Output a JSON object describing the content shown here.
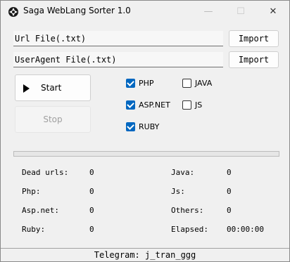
{
  "window": {
    "title": "Saga WebLang Sorter 1.0"
  },
  "titlebar": {
    "minimize": "—",
    "maximize": "☐",
    "close": "✕"
  },
  "inputs": {
    "url_file": "Url File(.txt)",
    "useragent_file": "UserAgent File(.txt)"
  },
  "buttons": {
    "import_url": "Import",
    "import_useragent": "Import",
    "start": "Start",
    "stop": "Stop"
  },
  "checkboxes": [
    {
      "label": "PHP",
      "checked": true
    },
    {
      "label": "JAVA",
      "checked": false
    },
    {
      "label": "ASP.NET",
      "checked": true
    },
    {
      "label": "JS",
      "checked": false
    },
    {
      "label": "RUBY",
      "checked": true
    }
  ],
  "progress": {
    "value": 0
  },
  "stats": {
    "dead_urls": {
      "label": "Dead urls:",
      "value": "0"
    },
    "php": {
      "label": "Php:",
      "value": "0"
    },
    "aspnet": {
      "label": "Asp.net:",
      "value": "0"
    },
    "ruby": {
      "label": "Ruby:",
      "value": "0"
    },
    "java": {
      "label": "Java:",
      "value": "0"
    },
    "js": {
      "label": "Js:",
      "value": "0"
    },
    "others": {
      "label": "Others:",
      "value": "0"
    },
    "elapsed": {
      "label": "Elapsed:",
      "value": "00:00:00"
    }
  },
  "footer": {
    "text": "Telegram: j_tran_ggg"
  },
  "colors": {
    "accent": "#0067c0",
    "progress": "#06b025"
  }
}
